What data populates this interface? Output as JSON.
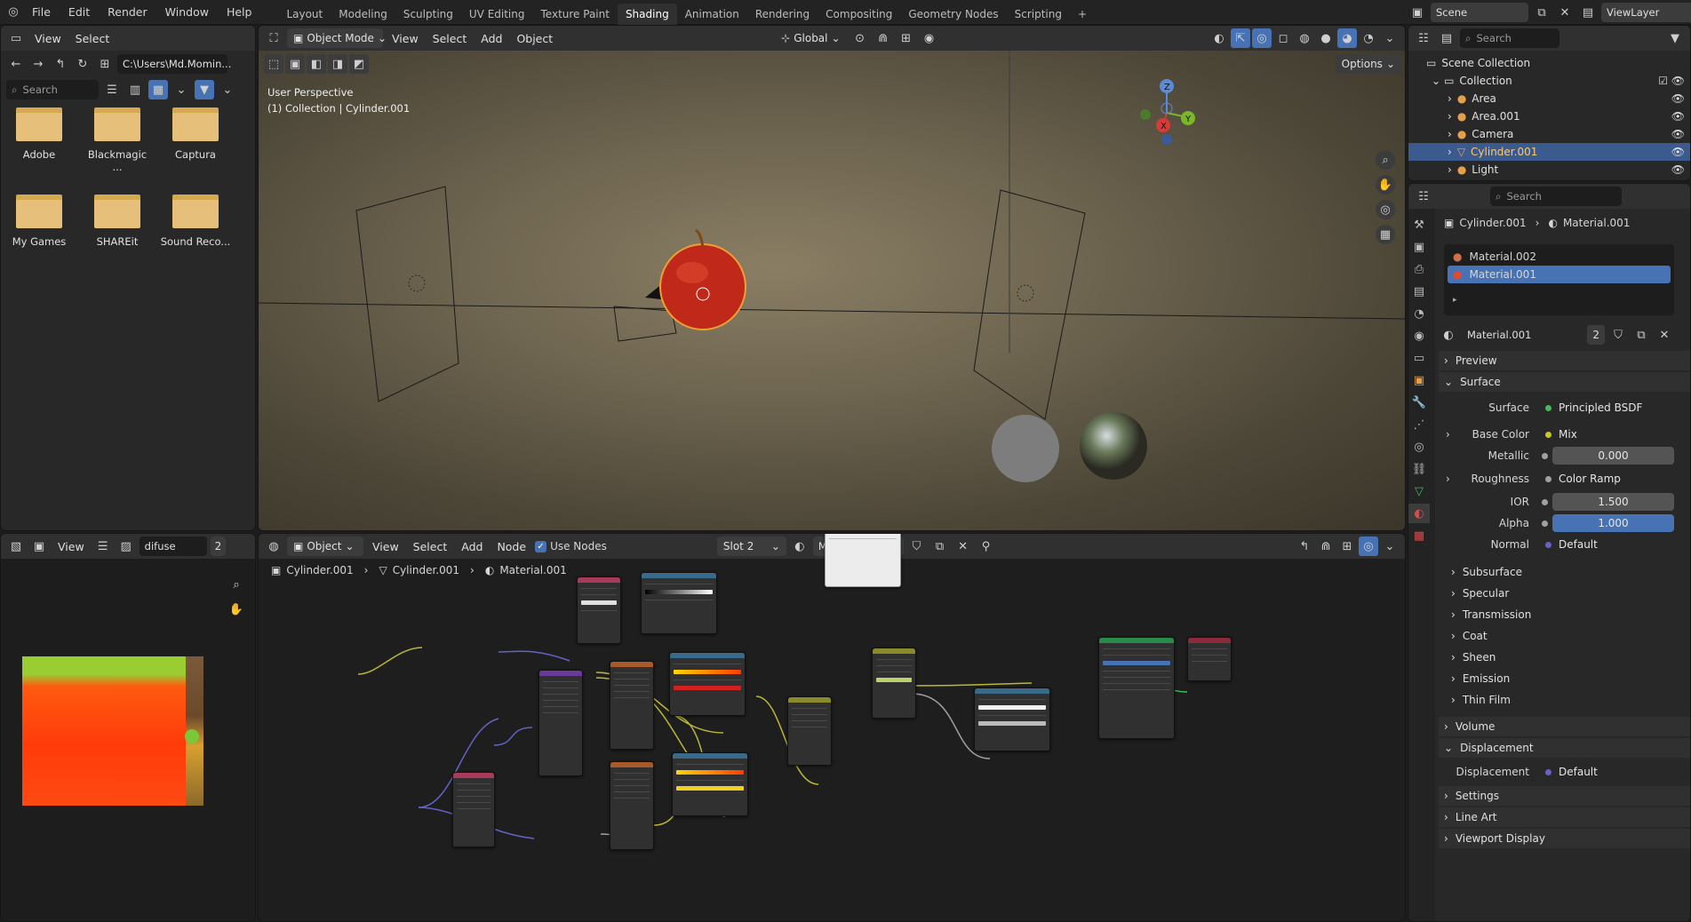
{
  "top_menu": [
    "File",
    "Edit",
    "Render",
    "Window",
    "Help"
  ],
  "workspaces": [
    "Layout",
    "Modeling",
    "Sculpting",
    "UV Editing",
    "Texture Paint",
    "Shading",
    "Animation",
    "Rendering",
    "Compositing",
    "Geometry Nodes",
    "Scripting"
  ],
  "active_workspace": "Shading",
  "scene": {
    "name": "Scene",
    "view_layer": "ViewLayer"
  },
  "file_browser": {
    "menu": [
      "View",
      "Select"
    ],
    "path": "C:\\Users\\Md.Momin...",
    "search_placeholder": "Search",
    "folders": [
      "Adobe",
      "Blackmagic ...",
      "Captura",
      "My Games",
      "SHAREit",
      "Sound Reco..."
    ]
  },
  "viewport": {
    "mode": "Object Mode",
    "menu": [
      "View",
      "Select",
      "Add",
      "Object"
    ],
    "transform": "Global",
    "options": "Options",
    "overlay_line1": "User Perspective",
    "overlay_line2": "(1) Collection | Cylinder.001",
    "gizmo": {
      "z": "Z",
      "y": "Y",
      "x": "X"
    }
  },
  "image_editor": {
    "menu": [
      "View"
    ],
    "image_name": "difuse",
    "users": "2"
  },
  "node_editor": {
    "type": "Object",
    "menu": [
      "View",
      "Select",
      "Add",
      "Node"
    ],
    "use_nodes": "Use Nodes",
    "slot": "Slot 2",
    "material": "Material.001",
    "users": "2",
    "breadcrumb": [
      "Cylinder.001",
      "Cylinder.001",
      "Material.001"
    ]
  },
  "outliner": {
    "search_placeholder": "Search",
    "root": "Scene Collection",
    "collection": "Collection",
    "items": [
      {
        "name": "Area",
        "selected": false
      },
      {
        "name": "Area.001",
        "selected": false
      },
      {
        "name": "Camera",
        "selected": false
      },
      {
        "name": "Cylinder.001",
        "selected": true
      },
      {
        "name": "Light",
        "selected": false
      }
    ]
  },
  "properties": {
    "search_placeholder": "Search",
    "breadcrumb_object": "Cylinder.001",
    "breadcrumb_material": "Material.001",
    "slots": [
      {
        "name": "Material.002",
        "selected": false
      },
      {
        "name": "Material.001",
        "selected": true
      }
    ],
    "material_name": "Material.001",
    "material_users": "2",
    "panels": {
      "preview": "Preview",
      "surface": "Surface",
      "subsurface": "Subsurface",
      "specular": "Specular",
      "transmission": "Transmission",
      "coat": "Coat",
      "sheen": "Sheen",
      "emission": "Emission",
      "thin_film": "Thin Film",
      "volume": "Volume",
      "displacement": "Displacement",
      "settings": "Settings",
      "line_art": "Line Art",
      "viewport_display": "Viewport Display"
    },
    "surface_fields": [
      {
        "label": "Surface",
        "value": "Principled BSDF",
        "dot": "#3dbd5a"
      },
      {
        "label": "Base Color",
        "value": "Mix",
        "dot": "#c7c729"
      },
      {
        "label": "Metallic",
        "value": "0.000",
        "dot": "#a1a1a1"
      },
      {
        "label": "Roughness",
        "value": "Color Ramp",
        "dot": "#a1a1a1"
      },
      {
        "label": "IOR",
        "value": "1.500",
        "dot": "#a1a1a1"
      },
      {
        "label": "Alpha",
        "value": "1.000",
        "dot": "#a1a1a1"
      },
      {
        "label": "Normal",
        "value": "Default",
        "dot": "#6363c7"
      }
    ],
    "displacement_field": {
      "label": "Displacement",
      "value": "Default",
      "dot": "#6363c7"
    }
  },
  "colors": {
    "accent": "#4772b3",
    "selected_row": "#3b5b8f",
    "header": "#303030",
    "panel": "#282828"
  }
}
